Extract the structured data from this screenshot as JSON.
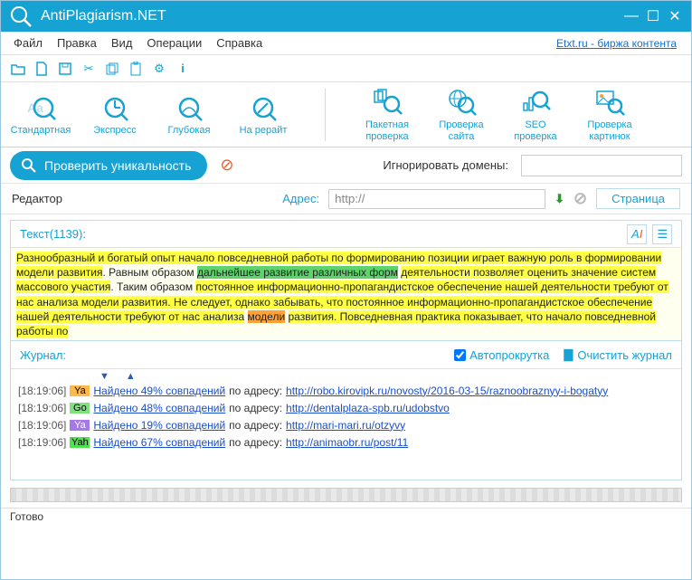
{
  "app": {
    "title": "AntiPlagiarism.NET"
  },
  "menu": {
    "file": "Файл",
    "edit": "Правка",
    "view": "Вид",
    "ops": "Операции",
    "help": "Справка",
    "etxt": "Etxt.ru - биржа контента"
  },
  "ribbon": {
    "left": [
      {
        "label": "Стандартная"
      },
      {
        "label": "Экспресс"
      },
      {
        "label": "Глубокая"
      },
      {
        "label": "На рерайт"
      }
    ],
    "right": [
      {
        "label": "Пакетная\nпроверка"
      },
      {
        "label": "Проверка\nсайта"
      },
      {
        "label": "SEO\nпроверка"
      },
      {
        "label": "Проверка\nкартинок"
      }
    ]
  },
  "check": {
    "button": "Проверить уникальность",
    "ignore_label": "Игнорировать домены:",
    "ignore_value": ""
  },
  "addr": {
    "editor": "Редактор",
    "label": "Адрес:",
    "value": "http://",
    "page": "Страница"
  },
  "editor": {
    "textlabel": "Текст(1139):",
    "body_html": "<span class='hly'>Разнообразный и богатый опыт начало повседневной работы по формированию позиции играет важную роль в формировании модели развития</span>. Равным образом <span class='hlg'>дальнейшее развитие различных форм</span> <span class='hly'>деятельности позволяет оценить значение систем массового участия</span>. Таким образом <span class='hly'>постоянное информационно-пропагандистское обеспечение нашей деятельности требуют от нас анализа модели развития. Не следует, однако забывать, что постоянное информационно-пропагандистское обеспечение нашей деятельности требуют от нас анализа</span> <span class='hlo'>модели</span> <span class='hly'>развития. Повседневная практика показывает, что начало повседневной работы по</span>"
  },
  "journal": {
    "label": "Журнал:",
    "autoscroll": "Автопрокрутка",
    "clear": "Очистить журнал",
    "rows": [
      {
        "time": "[18:19:06]",
        "engine": "Ya",
        "engineClass": "eYa",
        "found": "Найдено 49% совпадений",
        "mid": " по адресу: ",
        "url": "http://robo.kirovipk.ru/novosty/2016-03-15/raznoobraznyy-i-bogatyy"
      },
      {
        "time": "[18:19:06]",
        "engine": "Go",
        "engineClass": "eGo",
        "found": "Найдено 48% совпадений",
        "mid": " по адресу: ",
        "url": "http://dentalplaza-spb.ru/udobstvo"
      },
      {
        "time": "[18:19:06]",
        "engine": "Ya",
        "engineClass": "eYa2",
        "found": "Найдено 19% совпадений",
        "mid": " по адресу: ",
        "url": "http://mari-mari.ru/otzyvy"
      },
      {
        "time": "[18:19:06]",
        "engine": "Yah",
        "engineClass": "eYah",
        "found": "Найдено 67% совпадений",
        "mid": " по адресу: ",
        "url": "http://animaobr.ru/post/11"
      }
    ]
  },
  "status": {
    "text": "Готово"
  }
}
